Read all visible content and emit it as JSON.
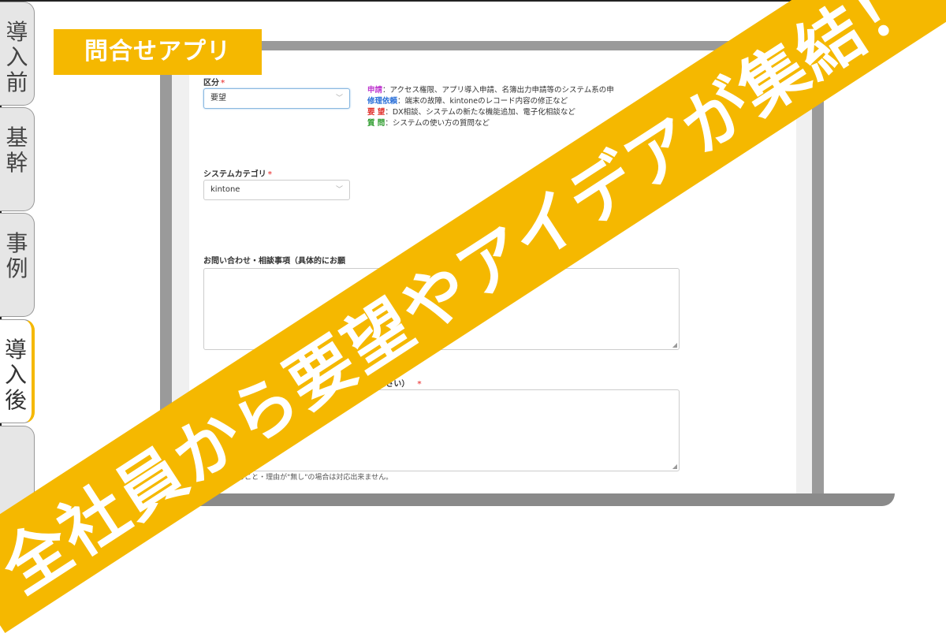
{
  "tabs": [
    {
      "label": "導入前",
      "active": false
    },
    {
      "label": "基幹",
      "active": false
    },
    {
      "label": "事例",
      "active": false
    },
    {
      "label": "導入後",
      "active": true
    }
  ],
  "app_tag": "問合せアプリ",
  "banner": "全社員から要望やアイデアが集結！",
  "form": {
    "category_label": "区分",
    "category_value": "要望",
    "help_lines": [
      {
        "key": "申請",
        "text": "：アクセス権限、アプリ導入申請、名簿出力申請等のシステム系の申"
      },
      {
        "key": "修理依頼",
        "text": "：端末の故障、kintoneのレコード内容の修正など"
      },
      {
        "key": "要 望",
        "text": "：DX相談、システムの新たな機能追加、電子化相談など"
      },
      {
        "key": "質 問",
        "text": "：システムの使い方の質問など"
      }
    ],
    "system_label": "システムカテゴリ",
    "system_value": "kintone",
    "inquiry_label": "お問い合わせ・相談事項（具体的にお願",
    "reason_label": "に書いてください）",
    "required_mark": "*",
    "note": "※困っていること・理由が\"無し\"の場合は対応出来ません。"
  },
  "colors": {
    "accent": "#f5b800",
    "key_apply": "#c03cd0",
    "key_repair": "#2a6fd8",
    "key_request": "#e0302a",
    "key_question": "#2a9a2a"
  }
}
